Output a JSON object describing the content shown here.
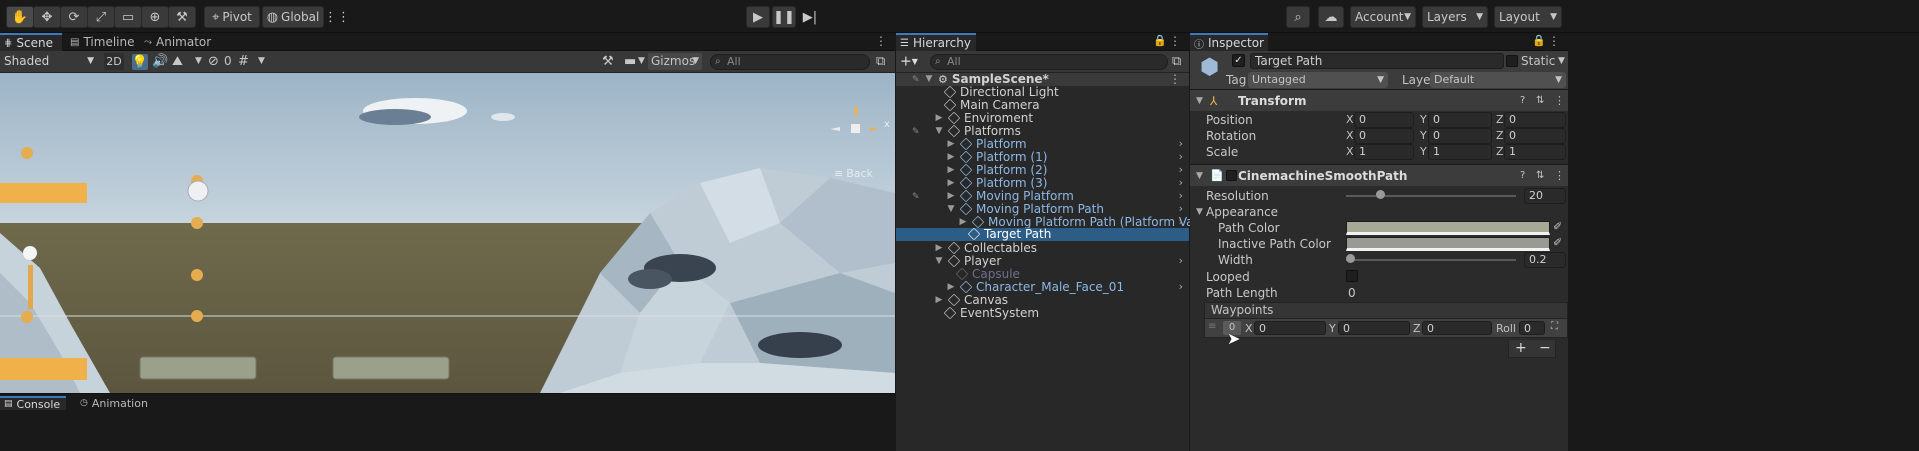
{
  "toolbar": {
    "pivot_label": "Pivot",
    "global_label": "Global",
    "account_label": "Account",
    "layers_label": "Layers",
    "layout_label": "Layout"
  },
  "scene_panel": {
    "tabs": [
      "Scene",
      "Timeline",
      "Animator"
    ],
    "shading_mode": "Shaded",
    "mode_2d": "2D",
    "hidden_count": "0",
    "gizmos_label": "Gizmos",
    "search_placeholder": "All",
    "back_label": "Back",
    "gizmo_x": "x",
    "bottom_tabs": [
      "Console",
      "Animation"
    ]
  },
  "hierarchy": {
    "tab_label": "Hierarchy",
    "search_placeholder": "All",
    "items": [
      {
        "label": "SampleScene*"
      },
      {
        "label": "Directional Light"
      },
      {
        "label": "Main Camera"
      },
      {
        "label": "Enviroment"
      },
      {
        "label": "Platforms"
      },
      {
        "label": "Platform"
      },
      {
        "label": "Platform (1)"
      },
      {
        "label": "Platform (2)"
      },
      {
        "label": "Platform (3)"
      },
      {
        "label": "Moving Platform"
      },
      {
        "label": "Moving Platform Path"
      },
      {
        "label": "Moving Platform Path (Platform Variant)"
      },
      {
        "label": "Target Path"
      },
      {
        "label": "Collectables"
      },
      {
        "label": "Player"
      },
      {
        "label": "Capsule"
      },
      {
        "label": "Character_Male_Face_01"
      },
      {
        "label": "Canvas"
      },
      {
        "label": "EventSystem"
      }
    ]
  },
  "inspector": {
    "tab_label": "Inspector",
    "object_name": "Target Path",
    "static_label": "Static",
    "tag_label": "Tag",
    "tag_value": "Untagged",
    "layer_label": "Layer",
    "layer_value": "Default",
    "transform": {
      "title": "Transform",
      "position_label": "Position",
      "rotation_label": "Rotation",
      "scale_label": "Scale",
      "axis_x": "X",
      "axis_y": "Y",
      "axis_z": "Z",
      "position": [
        "0",
        "0",
        "0"
      ],
      "rotation": [
        "0",
        "0",
        "0"
      ],
      "scale": [
        "1",
        "1",
        "1"
      ]
    },
    "cinemachine": {
      "title": "CinemachineSmoothPath",
      "resolution_label": "Resolution",
      "resolution_value": "20",
      "resolution_slider_fraction": 0.2,
      "appearance_label": "Appearance",
      "path_color_label": "Path Color",
      "inactive_path_color_label": "Inactive Path Color",
      "width_label": "Width",
      "width_value": "0.2",
      "width_slider_fraction": 0.0,
      "looped_label": "Looped",
      "path_length_label": "Path Length",
      "path_length_value": "0",
      "waypoints_label": "Waypoints",
      "waypoint": {
        "index": "0",
        "x": "0",
        "y": "0",
        "z": "0",
        "roll_label": "Roll",
        "roll": "0"
      },
      "add_symbol": "+",
      "remove_symbol": "−"
    }
  },
  "colors": {
    "accent": "#3a79bb",
    "selection": "#2c5d87",
    "sky": "#a9bfd0",
    "ground": "#6c6648",
    "platform_orange": "#f0b14a",
    "coin": "#e5ad4f"
  }
}
